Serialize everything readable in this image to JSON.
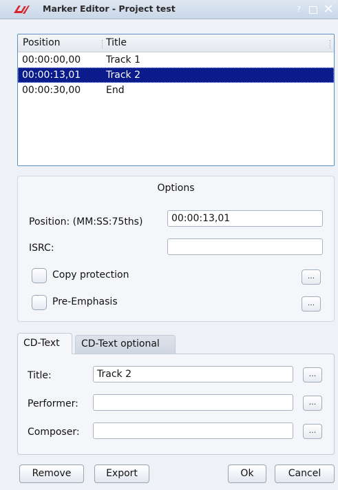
{
  "window": {
    "title": "Marker Editor - Project test",
    "help_glyph": "?",
    "close_glyph": "✕"
  },
  "marker_list": {
    "columns": [
      "Position",
      "Title"
    ],
    "rows": [
      {
        "position": "00:00:00,00",
        "title": "Track 1",
        "selected": false
      },
      {
        "position": "00:00:13,01",
        "title": "Track 2",
        "selected": true
      },
      {
        "position": "00:00:30,00",
        "title": "End",
        "selected": false
      }
    ]
  },
  "options": {
    "title": "Options",
    "position_label": "Position: (MM:SS:75ths)",
    "position_value": "00:00:13,01",
    "isrc_label": "ISRC:",
    "isrc_value": "",
    "copy_protection_label": "Copy protection",
    "copy_protection_checked": false,
    "pre_emphasis_label": "Pre-Emphasis",
    "pre_emphasis_checked": false,
    "more_label": "..."
  },
  "tabs": [
    {
      "label": "CD-Text",
      "active": true
    },
    {
      "label": "CD-Text optional",
      "active": false
    }
  ],
  "cd_text": {
    "title_label": "Title:",
    "title_value": "Track 2",
    "performer_label": "Performer:",
    "performer_value": "",
    "composer_label": "Composer:",
    "composer_value": "",
    "more_label": "..."
  },
  "buttons": {
    "remove": "Remove",
    "export": "Export",
    "ok": "Ok",
    "cancel": "Cancel"
  },
  "colors": {
    "selection": "#0a1b8c",
    "list_border": "#5d8fc6",
    "titlebar": "#c9d7e8",
    "app_icon": "#d6262c"
  },
  "icons": {
    "app": "k3b-logo-icon",
    "maximize": "maximize-icon",
    "close": "close-icon",
    "help": "help-icon"
  }
}
